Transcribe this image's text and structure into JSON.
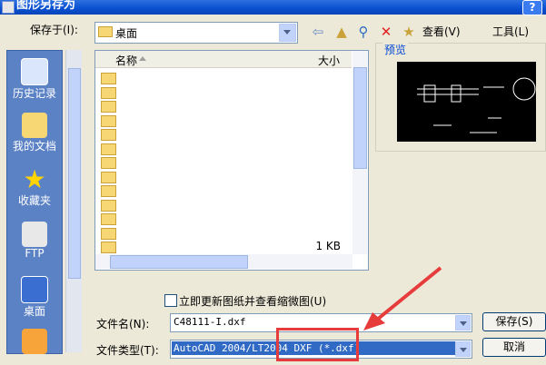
{
  "window": {
    "title": "图形另存为",
    "help": "?"
  },
  "save_in": {
    "label": "保存于(I):",
    "value": "桌面"
  },
  "toolbar": {
    "view_label": "查看(V)",
    "tools_label": "工具(L)"
  },
  "places": [
    "历史记录",
    "我的文档",
    "收藏夹",
    "FTP",
    "桌面"
  ],
  "file_list": {
    "columns": {
      "name": "名称",
      "size": "大小"
    },
    "rows": [
      {
        "name": "",
        "size": ""
      },
      {
        "name": "",
        "size": ""
      },
      {
        "name": "",
        "size": ""
      },
      {
        "name": "",
        "size": ""
      },
      {
        "name": "",
        "size": ""
      },
      {
        "name": "",
        "size": ""
      },
      {
        "name": "",
        "size": ""
      },
      {
        "name": "",
        "size": ""
      },
      {
        "name": "",
        "size": ""
      },
      {
        "name": "",
        "size": ""
      },
      {
        "name": "",
        "size": ""
      },
      {
        "name": "",
        "size": ""
      },
      {
        "name": "",
        "size": "1 KB"
      },
      {
        "name": "",
        "size": "1 KB"
      }
    ]
  },
  "preview": {
    "label": "预览"
  },
  "update_checkbox": {
    "label": "立即更新图纸并查看缩微图(U)",
    "checked": false
  },
  "file_name": {
    "label": "文件名(N):",
    "value": "C48111-I.dxf"
  },
  "file_type": {
    "label": "文件类型(T):",
    "value": "AutoCAD 2004/LT2004 DXF (*.dxf)"
  },
  "buttons": {
    "save": "保存(S)",
    "cancel": "取消"
  },
  "colors": {
    "title_bar": "#0a4fd0",
    "places_bar": "#5c82c6",
    "selection": "#316ac5",
    "annotation": "#e63c3c"
  }
}
